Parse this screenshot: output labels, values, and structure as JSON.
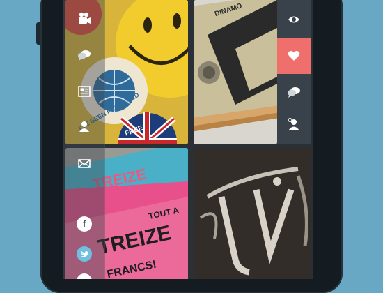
{
  "app": {
    "nav": [
      {
        "icon": "video-camera-icon"
      },
      {
        "icon": "chat-bubbles-icon"
      },
      {
        "icon": "newspaper-icon"
      },
      {
        "icon": "user-icon"
      },
      {
        "icon": "mail-icon"
      }
    ],
    "social": [
      {
        "icon": "facebook-icon",
        "glyph": "f"
      },
      {
        "icon": "twitter-icon",
        "glyph": "t"
      }
    ],
    "actions": [
      {
        "icon": "eye-icon"
      },
      {
        "icon": "heart-icon",
        "active": true
      },
      {
        "icon": "comments-icon"
      },
      {
        "icon": "user-add-icon"
      }
    ]
  },
  "photos": {
    "badge_text": "I'VE BEEN PROMOTED",
    "badge_bottom_text": "FREE",
    "book_spine_text": "DINAMO",
    "card_top_text": "TREIZE",
    "card_mid_text": "TOUT A",
    "card_big_text": "TREIZE",
    "card_bottom_text": "FRANCS!"
  },
  "colors": {
    "background": "#69a8c4",
    "accent_heart": "#ee6f6b",
    "rail": "#39424a"
  }
}
